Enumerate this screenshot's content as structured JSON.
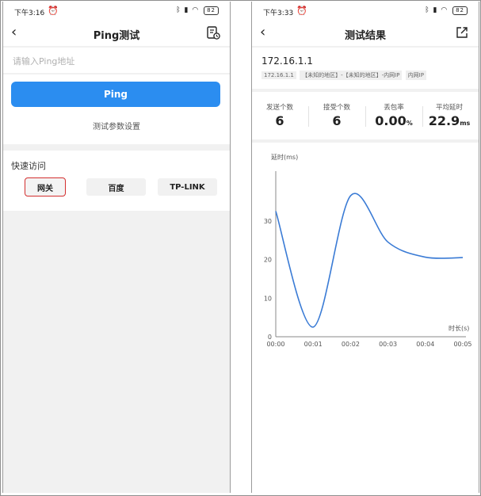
{
  "left": {
    "status": {
      "time": "下午3:16",
      "battery": "82"
    },
    "nav": {
      "title": "Ping测试"
    },
    "input": {
      "placeholder": "请输入Ping地址",
      "value": ""
    },
    "ping_button": "Ping",
    "params_link": "测试参数设置",
    "quick": {
      "title": "快速访问",
      "items": [
        {
          "label": "网关",
          "selected": true
        },
        {
          "label": "百度",
          "selected": false
        },
        {
          "label": "TP-LINK",
          "selected": false
        }
      ]
    }
  },
  "right": {
    "status": {
      "time": "下午3:33",
      "battery": "82"
    },
    "nav": {
      "title": "测试结果"
    },
    "ip": "172.16.1.1",
    "tags": [
      "172.16.1.1",
      "【未知的地区】-【未知的地区】-内网IP",
      "内网IP"
    ],
    "stats": [
      {
        "label": "发送个数",
        "value": "6",
        "unit": ""
      },
      {
        "label": "接受个数",
        "value": "6",
        "unit": ""
      },
      {
        "label": "丢包率",
        "value": "0.00",
        "unit": "%"
      },
      {
        "label": "平均延时",
        "value": "22.9",
        "unit": "ms"
      }
    ]
  },
  "colors": {
    "accent": "#2b8df0",
    "selected_outline": "#d32f2f"
  },
  "chart_data": {
    "type": "line",
    "ylabel": "延时(ms)",
    "xlabel": "时长(s)",
    "x": [
      "00:00",
      "00:01",
      "00:02",
      "00:03",
      "00:04",
      "00:05"
    ],
    "yticks": [
      0,
      10,
      20,
      30
    ],
    "ylim": [
      0,
      40
    ],
    "series": [
      {
        "values": [
          32.5,
          2.5,
          36.5,
          24.5,
          20.6,
          20.5
        ]
      }
    ],
    "grid": false,
    "color": "#3a7bd5"
  }
}
